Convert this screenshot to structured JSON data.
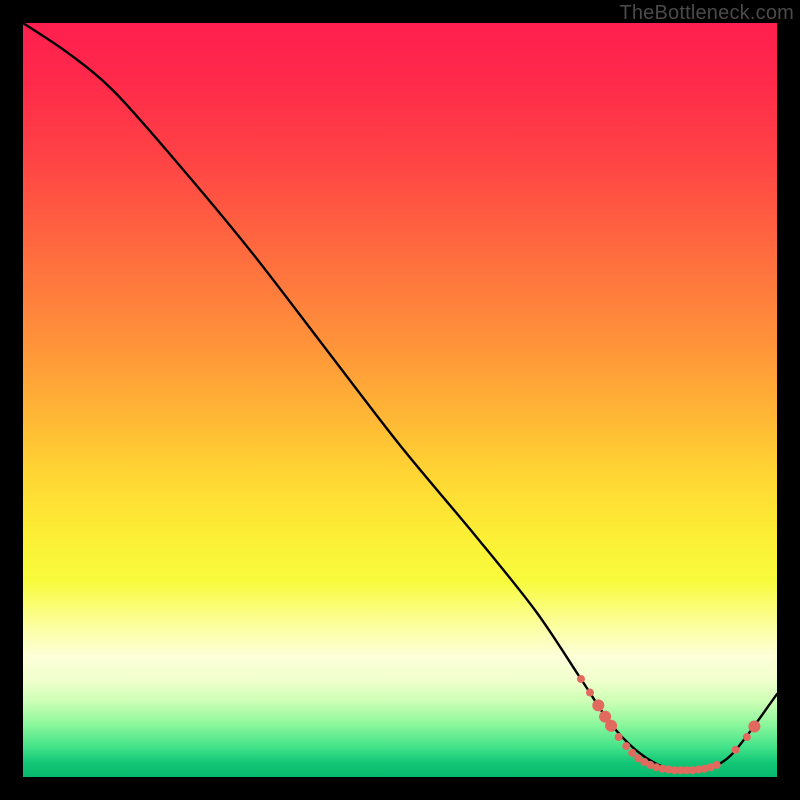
{
  "watermark": "TheBottleneck.com",
  "chart_data": {
    "type": "line",
    "title": "",
    "xlabel": "",
    "ylabel": "",
    "xlim": [
      0,
      100
    ],
    "ylim": [
      0,
      100
    ],
    "grid": false,
    "legend": false,
    "series": [
      {
        "name": "bottleneck-curve",
        "x": [
          0,
          6,
          12,
          20,
          30,
          40,
          50,
          60,
          68,
          74,
          78,
          82,
          86,
          90,
          94,
          100
        ],
        "y": [
          100,
          96,
          91,
          82,
          70,
          57,
          44,
          32,
          22,
          13,
          7,
          3,
          1,
          1,
          3,
          11
        ],
        "color": "#000000"
      }
    ],
    "markers": {
      "name": "highlight-dots",
      "color": "#e2695e",
      "radius_small": 4,
      "radius_large": 6,
      "points": [
        {
          "x": 74.0,
          "y": 13.0,
          "r": "small"
        },
        {
          "x": 75.2,
          "y": 11.2,
          "r": "small"
        },
        {
          "x": 76.3,
          "y": 9.5,
          "r": "large"
        },
        {
          "x": 77.2,
          "y": 8.0,
          "r": "large"
        },
        {
          "x": 78.0,
          "y": 6.8,
          "r": "large"
        },
        {
          "x": 79.0,
          "y": 5.3,
          "r": "small"
        },
        {
          "x": 80.0,
          "y": 4.1,
          "r": "small"
        },
        {
          "x": 80.8,
          "y": 3.2,
          "r": "small"
        },
        {
          "x": 81.6,
          "y": 2.5,
          "r": "small"
        },
        {
          "x": 82.4,
          "y": 2.0,
          "r": "small"
        },
        {
          "x": 83.2,
          "y": 1.6,
          "r": "small"
        },
        {
          "x": 84.0,
          "y": 1.3,
          "r": "small"
        },
        {
          "x": 84.8,
          "y": 1.1,
          "r": "small"
        },
        {
          "x": 85.6,
          "y": 1.0,
          "r": "small"
        },
        {
          "x": 86.4,
          "y": 0.9,
          "r": "small"
        },
        {
          "x": 87.2,
          "y": 0.9,
          "r": "small"
        },
        {
          "x": 88.0,
          "y": 0.9,
          "r": "small"
        },
        {
          "x": 88.8,
          "y": 0.9,
          "r": "small"
        },
        {
          "x": 89.6,
          "y": 1.0,
          "r": "small"
        },
        {
          "x": 90.4,
          "y": 1.1,
          "r": "small"
        },
        {
          "x": 91.2,
          "y": 1.3,
          "r": "small"
        },
        {
          "x": 92.0,
          "y": 1.6,
          "r": "small"
        },
        {
          "x": 94.5,
          "y": 3.6,
          "r": "small"
        },
        {
          "x": 96.0,
          "y": 5.3,
          "r": "small"
        },
        {
          "x": 97.0,
          "y": 6.7,
          "r": "large"
        }
      ]
    }
  }
}
